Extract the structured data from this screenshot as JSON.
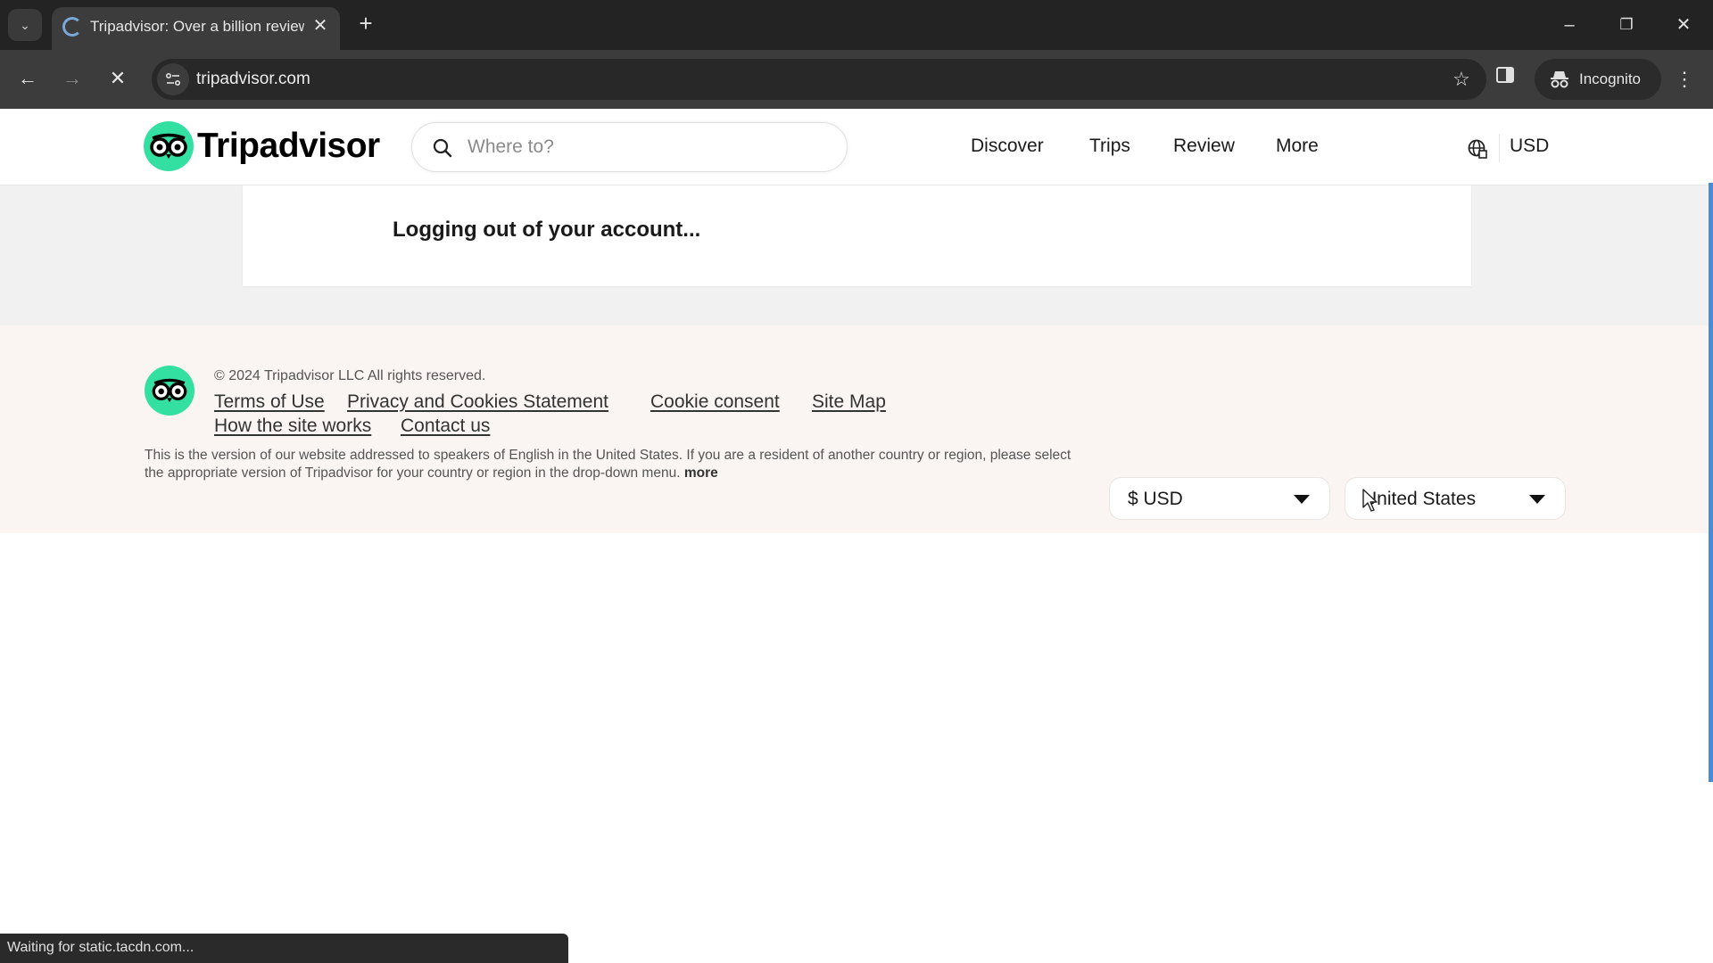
{
  "browser": {
    "tab_title": "Tripadvisor: Over a billion reviews",
    "url": "tripadvisor.com",
    "incognito_label": "Incognito",
    "status_text": "Waiting for static.tacdn.com...",
    "icons": {
      "tab_list": "chevron-down-icon",
      "tab_loading": "spinner-icon",
      "tab_close": "close-icon",
      "new_tab": "plus-icon",
      "back": "arrow-left-icon",
      "forward": "arrow-right-icon",
      "stop": "close-icon",
      "site_info": "tune-icon",
      "bookmark": "star-icon",
      "side_panel": "side-panel-icon",
      "incognito": "incognito-icon",
      "menu": "kebab-icon"
    },
    "glyphs": {
      "tab_list": "⌄",
      "tab_close": "✕",
      "new_tab": "+",
      "back": "←",
      "forward": "→",
      "stop": "✕",
      "bookmark": "☆",
      "menu": "⋮",
      "minimize": "–",
      "restore": "❐",
      "close": "✕"
    }
  },
  "header": {
    "brand": "Tripadvisor",
    "search_placeholder": "Where to?",
    "nav": [
      "Discover",
      "Trips",
      "Review",
      "More"
    ],
    "currency": "USD",
    "brand_color": "#34e0a1"
  },
  "main": {
    "message": "Logging out of your account..."
  },
  "footer": {
    "copyright": "© 2024 Tripadvisor LLC All rights reserved.",
    "links_row1": [
      "Terms of Use",
      "Privacy and Cookies Statement",
      "Cookie consent",
      "Site Map"
    ],
    "links_row2": [
      "How the site works",
      "Contact us"
    ],
    "disclaimer": "This is the version of our website addressed to speakers of English in the United States. If you are a resident of another country or region, please select the appropriate version of Tripadvisor for your country or region in the drop-down menu.",
    "more_label": "more",
    "currency_select": "$ USD",
    "country_select": "United States"
  }
}
